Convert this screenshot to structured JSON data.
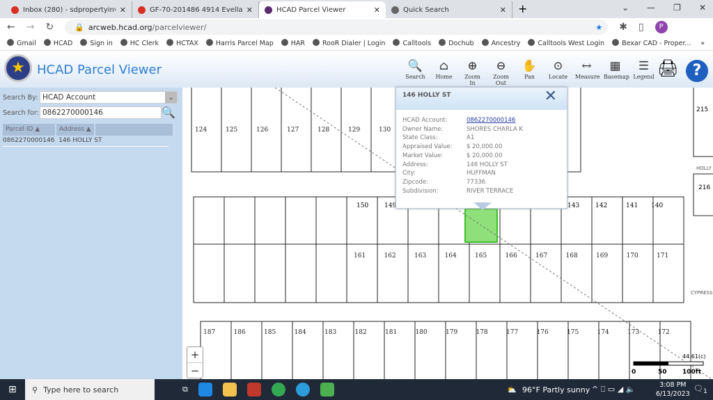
{
  "browser": {
    "tabs": [
      {
        "label": "Inbox (280) - sdpropertyinvestme",
        "icon": "gmail-icon"
      },
      {
        "label": "GF-70-201486 4914 Evella Street",
        "icon": "gmail-icon"
      },
      {
        "label": "HCAD Parcel Viewer",
        "icon": "hcad-icon",
        "active": true
      },
      {
        "label": "Quick Search",
        "icon": "globe-icon"
      }
    ],
    "url_host": "arcweb.hcad.org",
    "url_path": "/parcelviewer/",
    "bookmarks": [
      "Gmail",
      "HCAD",
      "Sign in",
      "HC Clerk",
      "HCTAX",
      "Harris Parcel Map",
      "HAR",
      "RooR Dialer | Login",
      "Calltools",
      "Dochub",
      "Ancestry",
      "Calltools West Login",
      "Bexar CAD - Proper..."
    ],
    "profile_initial": "P"
  },
  "app": {
    "title": "HCAD Parcel Viewer",
    "tools": [
      {
        "label": "Search",
        "glyph": "🔍"
      },
      {
        "label": "Home",
        "glyph": "⌂"
      },
      {
        "label": "Zoom In",
        "glyph": "⊕"
      },
      {
        "label": "Zoom Out",
        "glyph": "⊖"
      },
      {
        "label": "Pan",
        "glyph": "✋"
      },
      {
        "label": "Locate",
        "glyph": "⊙"
      },
      {
        "label": "Measure",
        "glyph": "↔"
      },
      {
        "label": "Basemap",
        "glyph": "▦"
      },
      {
        "label": "Legend",
        "glyph": "☰"
      }
    ]
  },
  "search": {
    "by_label": "Search By:",
    "by_value": "HCAD Account",
    "for_label": "Search for:",
    "for_value": "0862270000146",
    "columns": [
      "Parcel ID ▲",
      "Address ▲"
    ],
    "results": [
      {
        "parcel_id": "0862270000146",
        "address": "146 HOLLY ST"
      }
    ]
  },
  "popup": {
    "title": "146 HOLLY ST",
    "close": "✕",
    "fields": [
      {
        "k": "HCAD Account:",
        "v": "0862270000146"
      },
      {
        "k": "Owner Name:",
        "v": "SHORES CHARLA K"
      },
      {
        "k": "State Class:",
        "v": "A1"
      },
      {
        "k": "Appraised Value:",
        "v": "$ 20,000.00"
      },
      {
        "k": "Market Value:",
        "v": "$ 20,000.00"
      },
      {
        "k": "Address:",
        "v": "146 HOLLY ST"
      },
      {
        "k": "City:",
        "v": "HUFFMAN"
      },
      {
        "k": "Zipcode:",
        "v": "77336"
      },
      {
        "k": "Subdivision:",
        "v": "RIVER TERRACE"
      }
    ]
  },
  "map": {
    "top_lots": [
      "124",
      "125",
      "126",
      "127",
      "128",
      "129",
      "130"
    ],
    "mid_upper_lots": [
      "150",
      "149",
      "143",
      "142",
      "141",
      "140"
    ],
    "mid_lower_lots": [
      "161",
      "162",
      "163",
      "164",
      "165",
      "166",
      "167",
      "168",
      "169",
      "170",
      "171"
    ],
    "bottom_lots": [
      "187",
      "186",
      "185",
      "184",
      "183",
      "182",
      "181",
      "180",
      "179",
      "178",
      "177",
      "176",
      "175",
      "174",
      "173",
      "172"
    ],
    "right_lots": [
      "215",
      "216"
    ],
    "streets": [
      "HOLLY",
      "CYPRESS"
    ],
    "highlight_color": "#8fe07a",
    "scale": [
      "0",
      "50",
      "100ft"
    ],
    "scale_note": "44.61(c)",
    "zoom_in": "+",
    "zoom_out": "−"
  },
  "taskbar": {
    "search_placeholder": "Type here to search",
    "weather": "96°F  Partly sunny",
    "time": "3:08 PM",
    "date": "6/13/2023",
    "notifications": "1"
  }
}
